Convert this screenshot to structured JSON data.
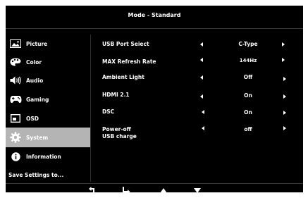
{
  "header": {
    "title": "Mode - Standard"
  },
  "sidebar": {
    "items": [
      {
        "label": "Picture",
        "icon": "picture-icon"
      },
      {
        "label": "Color",
        "icon": "palette-icon"
      },
      {
        "label": "Audio",
        "icon": "speaker-icon"
      },
      {
        "label": "Gaming",
        "icon": "gamepad-icon"
      },
      {
        "label": "OSD",
        "icon": "osd-window-icon"
      },
      {
        "label": "System",
        "icon": "gear-icon",
        "selected": true
      },
      {
        "label": "Information",
        "icon": "info-icon"
      },
      {
        "label": "Save Settings to...",
        "icon": null
      }
    ]
  },
  "settings": [
    {
      "label": "USB Port Seiect",
      "value": "C-Type"
    },
    {
      "label": "MAX Refresh Rate",
      "value": "144Hz"
    },
    {
      "label": "Ambient Light",
      "value": "Off"
    },
    {
      "label": "HDMI 2.1",
      "value": "On"
    },
    {
      "label": "DSC",
      "value": "On"
    },
    {
      "label": "Power-off",
      "label_line2": "USB charge",
      "value": "off"
    }
  ],
  "footer": {
    "buttons": [
      "back-icon",
      "enter-icon",
      "up-arrow-icon",
      "down-arrow-icon"
    ]
  },
  "colors": {
    "background": "#000000",
    "text": "#ffffff",
    "selected_item": "#b4b4b4",
    "page": "#ffffff"
  }
}
